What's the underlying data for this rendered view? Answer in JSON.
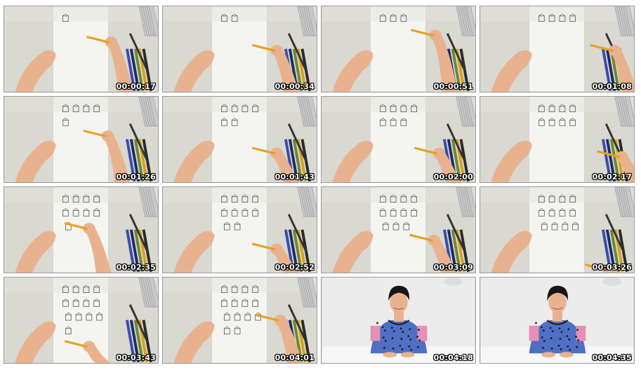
{
  "thumbnails": [
    {
      "scene": "drawing",
      "timestamp": "00:00:17"
    },
    {
      "scene": "drawing",
      "timestamp": "00:00:34"
    },
    {
      "scene": "drawing",
      "timestamp": "00:00:51"
    },
    {
      "scene": "drawing",
      "timestamp": "00:01:08"
    },
    {
      "scene": "drawing",
      "timestamp": "00:01:26"
    },
    {
      "scene": "drawing",
      "timestamp": "00:01:43"
    },
    {
      "scene": "drawing",
      "timestamp": "00:02:00"
    },
    {
      "scene": "drawing",
      "timestamp": "00:02:17"
    },
    {
      "scene": "drawing",
      "timestamp": "00:02:35"
    },
    {
      "scene": "drawing",
      "timestamp": "00:02:52"
    },
    {
      "scene": "drawing",
      "timestamp": "00:03:09"
    },
    {
      "scene": "drawing",
      "timestamp": "00:03:26"
    },
    {
      "scene": "drawing",
      "timestamp": "00:03:43"
    },
    {
      "scene": "drawing",
      "timestamp": "00:04:01"
    },
    {
      "scene": "presenter",
      "timestamp": "00:04:18"
    },
    {
      "scene": "presenter",
      "timestamp": "00:04:35"
    }
  ],
  "colors": {
    "desk": "#d9d8d1",
    "paper": "#f4f4f1",
    "skin": "#e9b28f",
    "pencil": "#e6a21f",
    "studio_wall": "#ececec",
    "studio_table": "#f7f7f7",
    "timestamp_text": "#ffffff"
  }
}
